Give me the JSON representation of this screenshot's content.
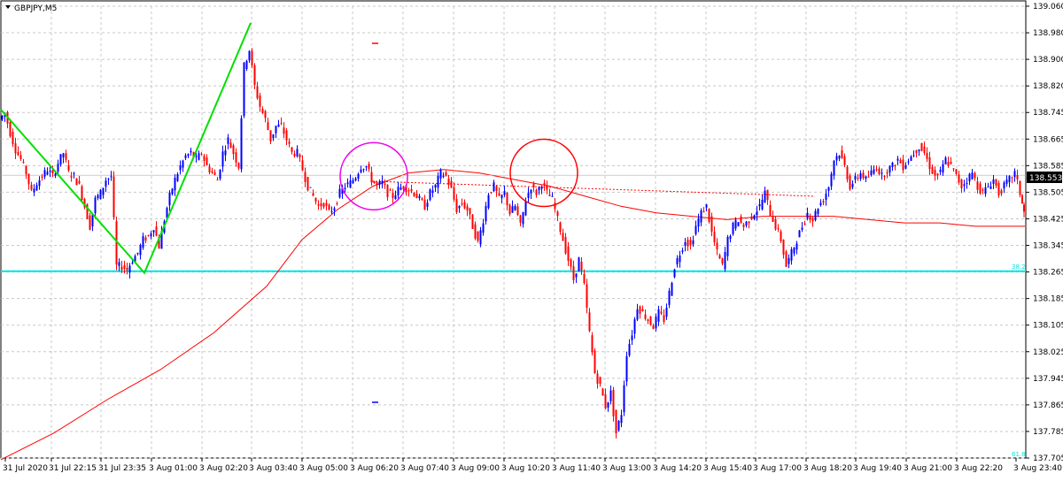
{
  "chart_data": {
    "type": "line",
    "symbol_label": "GBPJPY,M5",
    "current_price": "138.553",
    "y_ticks": [
      "139.060",
      "138.980",
      "138.900",
      "138.820",
      "138.745",
      "138.665",
      "138.585",
      "138.505",
      "138.425",
      "138.345",
      "138.265",
      "138.185",
      "138.105",
      "138.025",
      "137.945",
      "137.865",
      "137.785",
      "137.705"
    ],
    "x_ticks": [
      "31 Jul 2020",
      "31 Jul 22:15",
      "31 Jul 23:35",
      "3 Aug 01:00",
      "3 Aug 02:20",
      "3 Aug 03:40",
      "3 Aug 05:00",
      "3 Aug 06:20",
      "3 Aug 07:40",
      "3 Aug 09:00",
      "3 Aug 10:20",
      "3 Aug 11:40",
      "3 Aug 13:00",
      "3 Aug 14:20",
      "3 Aug 15:40",
      "3 Aug 17:00",
      "3 Aug 18:20",
      "3 Aug 19:40",
      "3 Aug 21:00",
      "3 Aug 22:20",
      "3 Aug 23:40"
    ],
    "ylim": [
      137.705,
      139.06
    ],
    "fib_labels": [
      "38.2",
      "61.8"
    ],
    "fib_382_price": 138.265,
    "grid": true,
    "colors": {
      "bull_candle": "#0000ff",
      "bear_candle": "#ff0000",
      "zigzag": "#00e000",
      "moving_average": "#ff0000",
      "fib_line": "#00e5e5",
      "circle_magenta": "#ee00ee",
      "circle_red": "#ff0000",
      "grid": "#c8c8c8"
    },
    "price_path": [
      [
        0,
        138.72
      ],
      [
        6,
        138.74
      ],
      [
        12,
        138.68
      ],
      [
        18,
        138.63
      ],
      [
        24,
        138.6
      ],
      [
        30,
        138.56
      ],
      [
        36,
        138.5
      ],
      [
        42,
        138.53
      ],
      [
        48,
        138.55
      ],
      [
        54,
        138.57
      ],
      [
        60,
        138.55
      ],
      [
        66,
        138.59
      ],
      [
        72,
        138.62
      ],
      [
        78,
        138.56
      ],
      [
        84,
        138.55
      ],
      [
        90,
        138.52
      ],
      [
        96,
        138.46
      ],
      [
        102,
        138.4
      ],
      [
        108,
        138.48
      ],
      [
        114,
        138.5
      ],
      [
        120,
        138.54
      ],
      [
        126,
        138.55
      ],
      [
        132,
        138.28
      ],
      [
        138,
        138.28
      ],
      [
        144,
        138.27
      ],
      [
        150,
        138.3
      ],
      [
        156,
        138.32
      ],
      [
        162,
        138.36
      ],
      [
        168,
        138.37
      ],
      [
        174,
        138.4
      ],
      [
        180,
        138.34
      ],
      [
        186,
        138.42
      ],
      [
        192,
        138.49
      ],
      [
        198,
        138.54
      ],
      [
        204,
        138.58
      ],
      [
        210,
        138.61
      ],
      [
        216,
        138.62
      ],
      [
        222,
        138.6
      ],
      [
        228,
        138.62
      ],
      [
        234,
        138.58
      ],
      [
        240,
        138.56
      ],
      [
        246,
        138.54
      ],
      [
        252,
        138.62
      ],
      [
        258,
        138.66
      ],
      [
        264,
        138.62
      ],
      [
        270,
        138.58
      ],
      [
        276,
        138.88
      ],
      [
        282,
        138.93
      ],
      [
        288,
        138.82
      ],
      [
        294,
        138.76
      ],
      [
        300,
        138.72
      ],
      [
        306,
        138.66
      ],
      [
        312,
        138.7
      ],
      [
        318,
        138.7
      ],
      [
        324,
        138.66
      ],
      [
        330,
        138.62
      ],
      [
        336,
        138.62
      ],
      [
        342,
        138.57
      ],
      [
        348,
        138.52
      ],
      [
        354,
        138.49
      ],
      [
        360,
        138.46
      ],
      [
        366,
        138.47
      ],
      [
        372,
        138.44
      ],
      [
        378,
        138.46
      ],
      [
        384,
        138.5
      ],
      [
        390,
        138.52
      ],
      [
        396,
        138.53
      ],
      [
        402,
        138.55
      ],
      [
        408,
        138.58
      ],
      [
        414,
        138.58
      ],
      [
        420,
        138.54
      ],
      [
        426,
        138.52
      ],
      [
        432,
        138.53
      ],
      [
        438,
        138.5
      ],
      [
        444,
        138.49
      ],
      [
        450,
        138.51
      ],
      [
        456,
        138.52
      ],
      [
        462,
        138.51
      ],
      [
        468,
        138.5
      ],
      [
        474,
        138.48
      ],
      [
        480,
        138.46
      ],
      [
        486,
        138.5
      ],
      [
        492,
        138.52
      ],
      [
        498,
        138.56
      ],
      [
        504,
        138.55
      ],
      [
        510,
        138.51
      ],
      [
        516,
        138.45
      ],
      [
        522,
        138.47
      ],
      [
        528,
        138.45
      ],
      [
        534,
        138.4
      ],
      [
        540,
        138.35
      ],
      [
        546,
        138.42
      ],
      [
        552,
        138.5
      ],
      [
        558,
        138.52
      ],
      [
        564,
        138.48
      ],
      [
        570,
        138.5
      ],
      [
        576,
        138.44
      ],
      [
        582,
        138.46
      ],
      [
        588,
        138.4
      ],
      [
        594,
        138.48
      ],
      [
        600,
        138.52
      ],
      [
        606,
        138.5
      ],
      [
        612,
        138.53
      ],
      [
        618,
        138.5
      ],
      [
        624,
        138.48
      ],
      [
        630,
        138.42
      ],
      [
        636,
        138.36
      ],
      [
        642,
        138.3
      ],
      [
        648,
        138.24
      ],
      [
        654,
        138.3
      ],
      [
        660,
        138.22
      ],
      [
        666,
        138.08
      ],
      [
        672,
        137.96
      ],
      [
        678,
        137.92
      ],
      [
        684,
        137.86
      ],
      [
        690,
        137.9
      ],
      [
        696,
        137.78
      ],
      [
        702,
        137.84
      ],
      [
        708,
        138.02
      ],
      [
        714,
        138.08
      ],
      [
        720,
        138.16
      ],
      [
        726,
        138.14
      ],
      [
        732,
        138.12
      ],
      [
        738,
        138.1
      ],
      [
        744,
        138.14
      ],
      [
        750,
        138.12
      ],
      [
        756,
        138.2
      ],
      [
        762,
        138.28
      ],
      [
        768,
        138.32
      ],
      [
        774,
        138.36
      ],
      [
        780,
        138.34
      ],
      [
        786,
        138.4
      ],
      [
        792,
        138.44
      ],
      [
        798,
        138.46
      ],
      [
        804,
        138.38
      ],
      [
        810,
        138.32
      ],
      [
        816,
        138.28
      ],
      [
        822,
        138.36
      ],
      [
        828,
        138.4
      ],
      [
        834,
        138.42
      ],
      [
        840,
        138.4
      ],
      [
        846,
        138.42
      ],
      [
        852,
        138.44
      ],
      [
        858,
        138.46
      ],
      [
        864,
        138.5
      ],
      [
        870,
        138.44
      ],
      [
        876,
        138.4
      ],
      [
        882,
        138.36
      ],
      [
        888,
        138.28
      ],
      [
        894,
        138.32
      ],
      [
        900,
        138.36
      ],
      [
        906,
        138.4
      ],
      [
        912,
        138.44
      ],
      [
        918,
        138.42
      ],
      [
        924,
        138.46
      ],
      [
        930,
        138.48
      ],
      [
        936,
        138.52
      ],
      [
        942,
        138.6
      ],
      [
        948,
        138.62
      ],
      [
        954,
        138.58
      ],
      [
        960,
        138.52
      ],
      [
        966,
        138.54
      ],
      [
        972,
        138.56
      ],
      [
        978,
        138.54
      ],
      [
        984,
        138.56
      ],
      [
        990,
        138.58
      ],
      [
        996,
        138.55
      ],
      [
        1002,
        138.57
      ],
      [
        1008,
        138.58
      ],
      [
        1014,
        138.6
      ],
      [
        1020,
        138.58
      ],
      [
        1026,
        138.6
      ],
      [
        1032,
        138.62
      ],
      [
        1038,
        138.64
      ],
      [
        1044,
        138.62
      ],
      [
        1050,
        138.58
      ],
      [
        1056,
        138.55
      ],
      [
        1062,
        138.56
      ],
      [
        1068,
        138.6
      ],
      [
        1074,
        138.58
      ],
      [
        1080,
        138.55
      ],
      [
        1086,
        138.52
      ],
      [
        1092,
        138.54
      ],
      [
        1098,
        138.56
      ],
      [
        1104,
        138.52
      ],
      [
        1110,
        138.5
      ],
      [
        1116,
        138.52
      ],
      [
        1122,
        138.54
      ],
      [
        1128,
        138.5
      ],
      [
        1134,
        138.52
      ],
      [
        1140,
        138.54
      ],
      [
        1146,
        138.56
      ],
      [
        1152,
        138.5
      ],
      [
        1156,
        138.44
      ]
    ],
    "moving_average": [
      [
        0,
        137.7
      ],
      [
        60,
        137.78
      ],
      [
        120,
        137.88
      ],
      [
        180,
        137.97
      ],
      [
        240,
        138.08
      ],
      [
        300,
        138.22
      ],
      [
        340,
        138.36
      ],
      [
        380,
        138.45
      ],
      [
        420,
        138.52
      ],
      [
        460,
        138.56
      ],
      [
        500,
        138.57
      ],
      [
        540,
        138.56
      ],
      [
        580,
        138.54
      ],
      [
        620,
        138.52
      ],
      [
        660,
        138.49
      ],
      [
        700,
        138.46
      ],
      [
        740,
        138.44
      ],
      [
        780,
        138.43
      ],
      [
        820,
        138.42
      ],
      [
        860,
        138.43
      ],
      [
        900,
        138.43
      ],
      [
        940,
        138.43
      ],
      [
        980,
        138.42
      ],
      [
        1020,
        138.41
      ],
      [
        1060,
        138.41
      ],
      [
        1100,
        138.4
      ],
      [
        1156,
        138.4
      ]
    ],
    "zigzag": [
      [
        0,
        138.75
      ],
      [
        162,
        138.26
      ],
      [
        282,
        139.01
      ]
    ],
    "circles": [
      {
        "name": "magenta",
        "x": 422,
        "price": 138.55
      },
      {
        "name": "red",
        "x": 614,
        "price": 138.56
      }
    ]
  }
}
